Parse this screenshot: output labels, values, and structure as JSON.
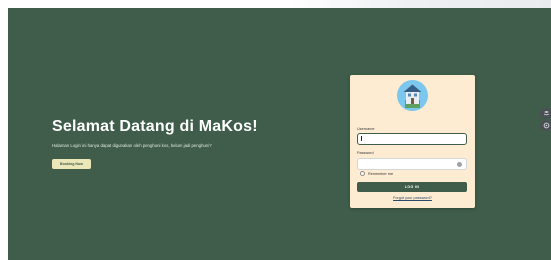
{
  "hero": {
    "title": "Selamat Datang di MaKos!",
    "subtitle": "Halaman Login ini hanya dapat digunakan oleh penghuni kos, belum jadi penghuni?",
    "cta_label": "Booking Now"
  },
  "login": {
    "username_label": "Username",
    "username_value": "",
    "password_label": "Password",
    "password_value": "",
    "remember_label": "Remember me",
    "remember_checked": false,
    "submit_label": "LOG IN",
    "forgot_label": "Forgot your password?"
  },
  "side_tools": [
    {
      "icon": "layers-icon"
    },
    {
      "icon": "settings-icon"
    }
  ],
  "colors": {
    "background": "#3f5d4a",
    "card": "#fdebd2",
    "accent_button": "#ece7b9",
    "logo_circle": "#7cc7ed"
  }
}
